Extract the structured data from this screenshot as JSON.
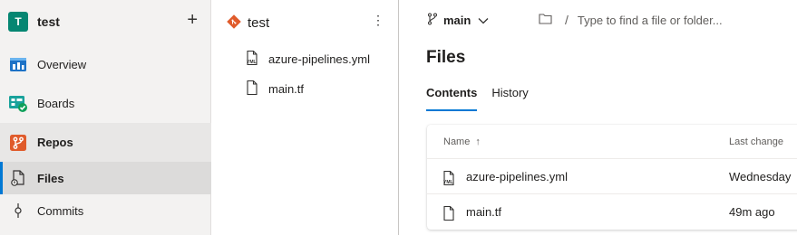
{
  "project": {
    "avatar_letter": "T",
    "name": "test",
    "add_label": "+"
  },
  "nav": {
    "items": [
      {
        "label": "Overview",
        "icon": "overview-icon"
      },
      {
        "label": "Boards",
        "icon": "boards-icon"
      },
      {
        "label": "Repos",
        "icon": "repos-icon"
      },
      {
        "label": "Files",
        "icon": "files-icon"
      },
      {
        "label": "Commits",
        "icon": "commits-icon"
      }
    ]
  },
  "tree": {
    "repo_name": "test",
    "more_label": "⋮",
    "files": [
      {
        "name": "azure-pipelines.yml",
        "icon": "yaml-file-icon"
      },
      {
        "name": "main.tf",
        "icon": "file-icon"
      }
    ]
  },
  "main": {
    "branch": "main",
    "path_sep": "/",
    "search_placeholder": "Type to find a file or folder...",
    "title": "Files",
    "tabs": [
      {
        "label": "Contents"
      },
      {
        "label": "History"
      }
    ],
    "table": {
      "col_name": "Name",
      "sort_arrow": "↑",
      "col_change": "Last change",
      "rows": [
        {
          "name": "azure-pipelines.yml",
          "last_change": "Wednesday"
        },
        {
          "name": "main.tf",
          "last_change": "49m ago"
        }
      ]
    }
  },
  "colors": {
    "accent": "#0078d4",
    "project_avatar": "#058672",
    "repos_icon": "#e05b2b"
  }
}
